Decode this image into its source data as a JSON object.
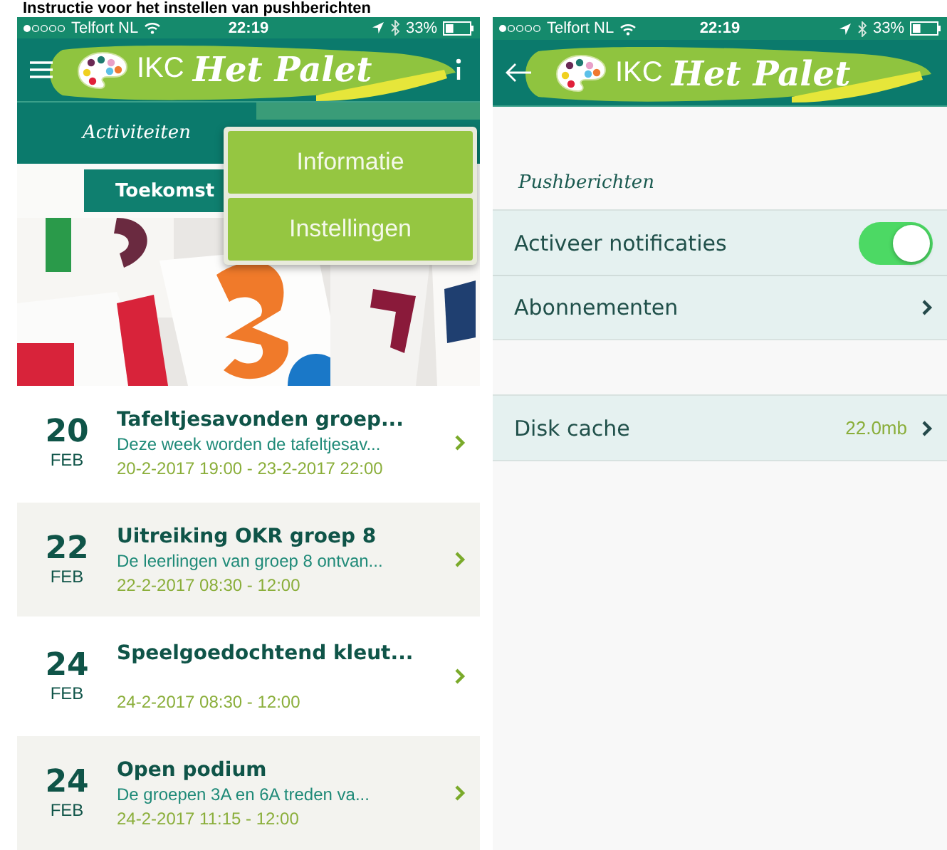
{
  "title": "Instructie voor het instellen van pushberichten",
  "screens": [
    {
      "status_bar": {
        "carrier": "Telfort NL",
        "time": "22:19",
        "battery": "33%"
      },
      "header": {
        "nav": {
          "kind": "menu"
        },
        "brand": "IKC",
        "name": "Het Palet",
        "action": {
          "kind": "info"
        }
      },
      "tabs": [
        {
          "label": "Activiteiten",
          "selected": false
        },
        {
          "selected": true
        }
      ],
      "segment": {
        "label": "Toekomst"
      },
      "events": [
        {
          "day": "20",
          "month": "FEB",
          "title": "Tafeltjesavonden groep...",
          "description": "Deze week worden de tafeltjesav...",
          "time": "20-2-2017 19:00 - 23-2-2017 22:00"
        },
        {
          "day": "22",
          "month": "FEB",
          "title": "Uitreiking OKR groep 8",
          "description": "De leerlingen van groep 8 ontvan...",
          "time": "22-2-2017 08:30 - 12:00"
        },
        {
          "day": "24",
          "month": "FEB",
          "title": "Speelgoedochtend kleut...",
          "time": "24-2-2017 08:30 - 12:00"
        },
        {
          "day": "24",
          "month": "FEB",
          "title": "Open podium",
          "description": "De groepen 3A en 6A treden va...",
          "time": "24-2-2017 11:15 - 12:00"
        }
      ],
      "menu": {
        "items": [
          "Informatie",
          "Instellingen"
        ]
      }
    },
    {
      "status_bar": {
        "carrier": "Telfort NL",
        "time": "22:19",
        "battery": "33%"
      },
      "header": {
        "nav": {
          "kind": "back"
        },
        "brand": "IKC",
        "name": "Het Palet"
      },
      "section_title": "Pushberichten",
      "groups": [
        [
          {
            "kind": "toggle",
            "label": "Activeer notificaties",
            "on": true
          },
          {
            "kind": "link",
            "label": "Abonnementen"
          }
        ],
        [
          {
            "kind": "link",
            "label": "Disk cache",
            "value": "22.0mb"
          }
        ]
      ]
    }
  ]
}
